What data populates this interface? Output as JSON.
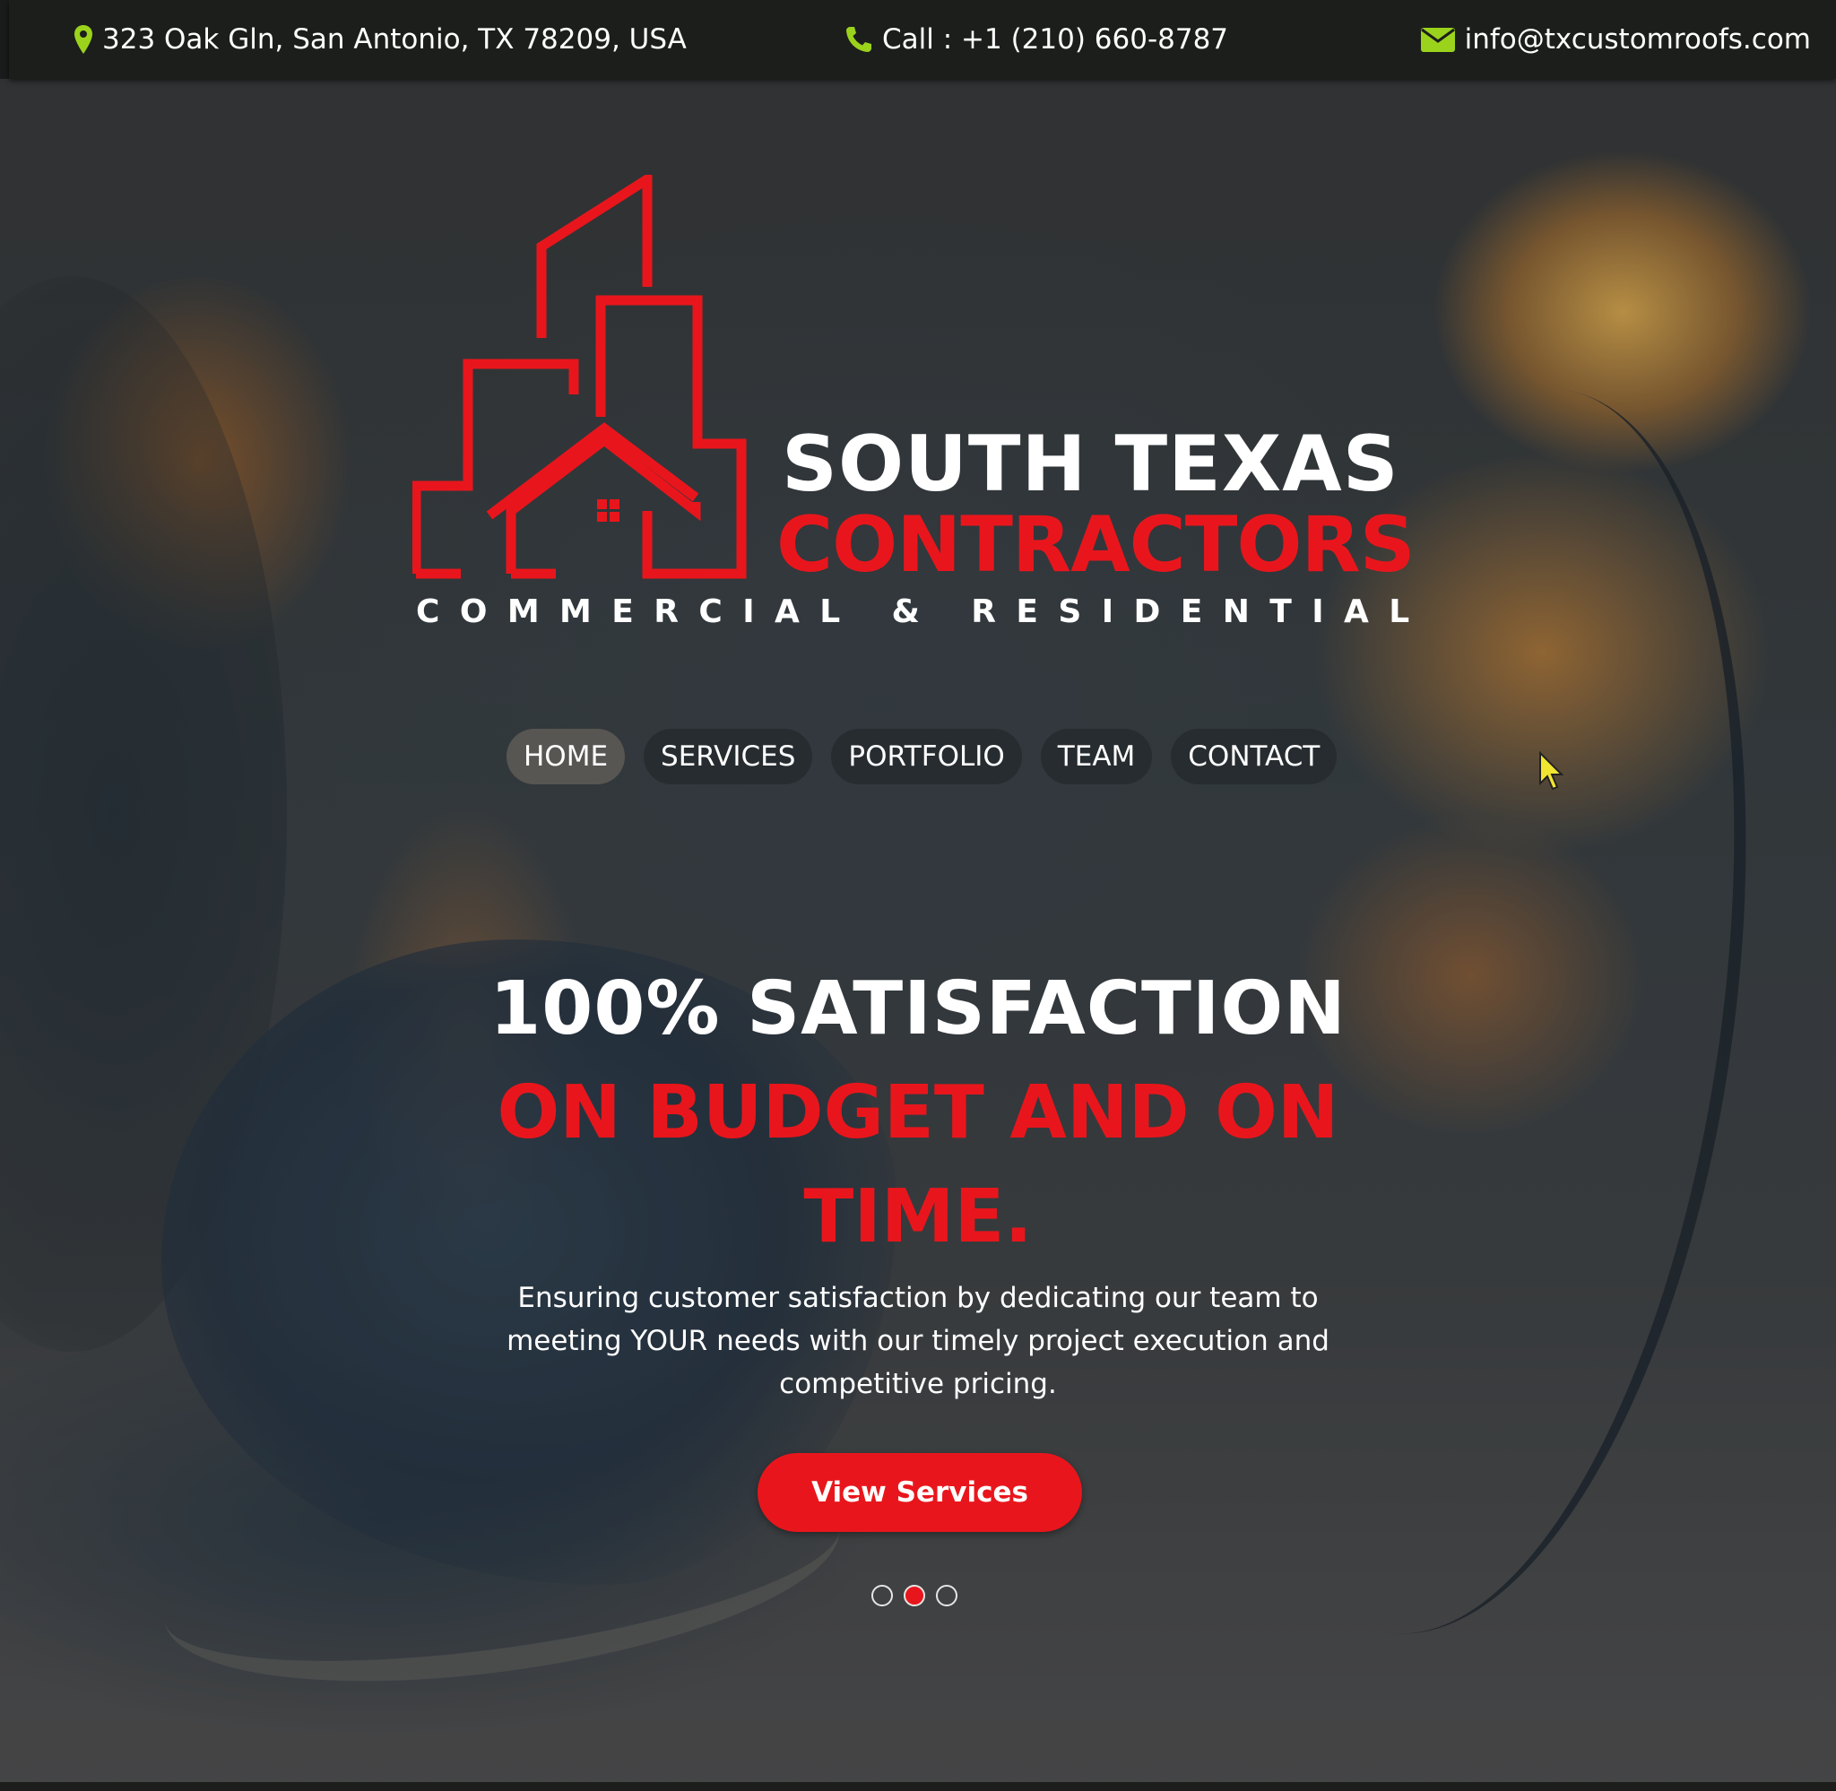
{
  "topbar": {
    "address": "323 Oak Gln, San Antonio, TX 78209, USA",
    "phone": "Call : +1 (210) 660-8787",
    "email": "info@txcustomroofs.com",
    "icon_color": "#9bd31c"
  },
  "logo": {
    "line1": "SOUTH TEXAS",
    "line2": "CONTRACTORS",
    "line3": "COMMERCIAL & RESIDENTIAL",
    "accent": "#e8161c"
  },
  "nav": {
    "items": [
      {
        "label": "HOME",
        "active": true
      },
      {
        "label": "SERVICES",
        "active": false
      },
      {
        "label": "PORTFOLIO",
        "active": false
      },
      {
        "label": "TEAM",
        "active": false
      },
      {
        "label": "CONTACT",
        "active": false
      }
    ]
  },
  "hero": {
    "headline_white": "100% SATISFACTION",
    "headline_red": "ON BUDGET AND ON TIME.",
    "subtext": "Ensuring customer satisfaction by dedicating our team to meeting YOUR needs with our timely project execution and competitive pricing.",
    "cta": "View Services",
    "slides": {
      "count": 3,
      "active": 2
    }
  }
}
